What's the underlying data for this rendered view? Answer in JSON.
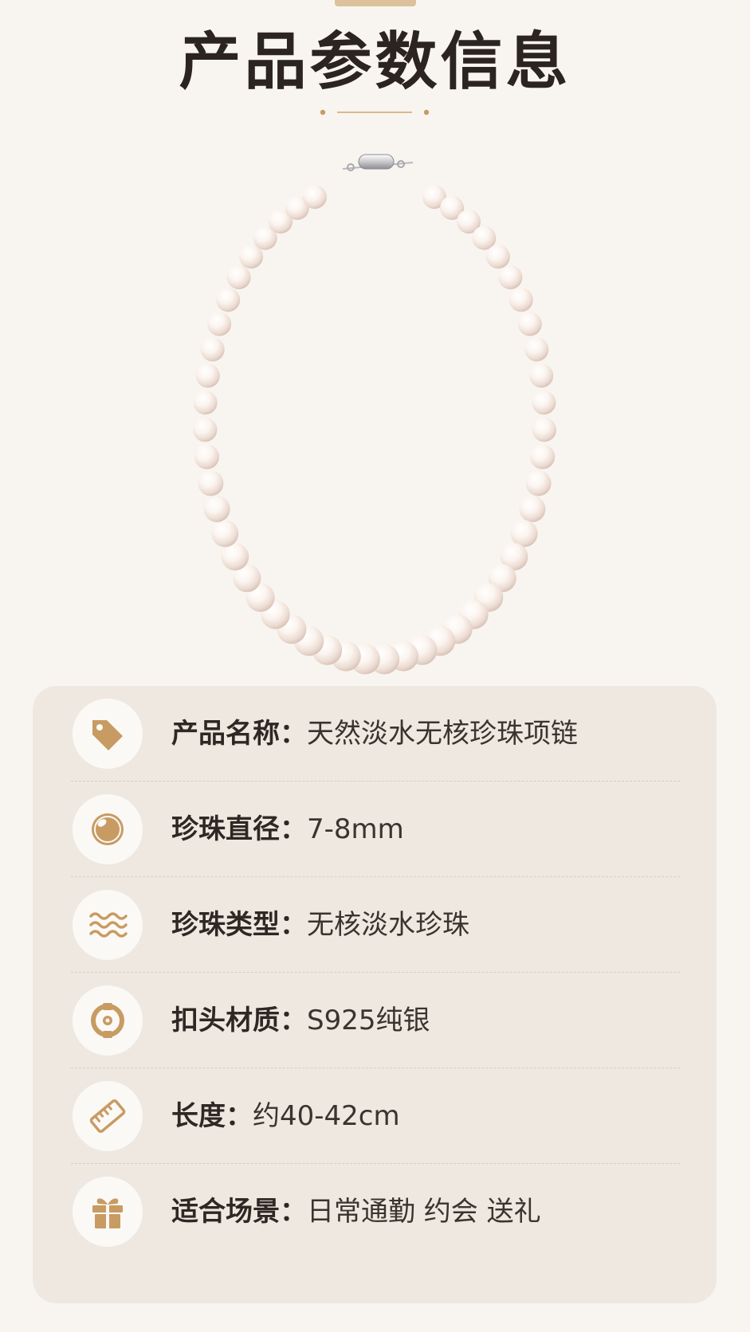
{
  "page": {
    "title": "产品参数信息"
  },
  "colors": {
    "accent_gold": "#c89b62",
    "card_bg": "#efe8e0",
    "title_text": "#2b2420"
  },
  "product_image": {
    "subject": "pearl-necklace"
  },
  "specs": [
    {
      "icon": "tag-icon",
      "label": "产品名称：",
      "value": "天然淡水无核珍珠项链"
    },
    {
      "icon": "pearl-icon",
      "label": "珍珠直径：",
      "value": "7-8mm"
    },
    {
      "icon": "waves-icon",
      "label": "珍珠类型：",
      "value": "无核淡水珍珠"
    },
    {
      "icon": "clasp-icon",
      "label": "扣头材质：",
      "value": "S925纯银"
    },
    {
      "icon": "ruler-icon",
      "label": "长度：",
      "value": "约40-42cm"
    },
    {
      "icon": "gift-icon",
      "label": "适合场景：",
      "value": "日常通勤 约会 送礼"
    }
  ]
}
